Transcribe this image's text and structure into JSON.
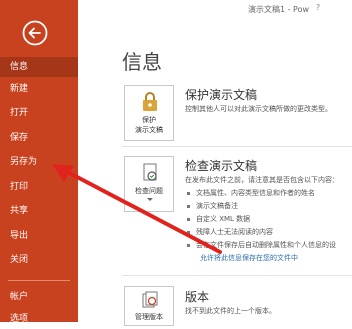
{
  "window": {
    "title": "演示文稿1 - Pow"
  },
  "sidebar": {
    "items": [
      {
        "label": "信息",
        "active": true
      },
      {
        "label": "新建"
      },
      {
        "label": "打开"
      },
      {
        "label": "保存"
      },
      {
        "label": "另存为"
      },
      {
        "label": "打印"
      },
      {
        "label": "共享"
      },
      {
        "label": "导出"
      },
      {
        "label": "关闭"
      },
      {
        "label": "帐户"
      },
      {
        "label": "选项"
      }
    ]
  },
  "main": {
    "title": "信息",
    "protect": {
      "button_line1": "保护",
      "button_line2": "演示文稿",
      "title": "保护演示文稿",
      "desc": "控制其他人可以对此演示文稿所做的更改类型。"
    },
    "inspect": {
      "button_label": "检查问题",
      "title": "检查演示文稿",
      "desc": "在发布此文件之前，请注意其是否包含以下内容：",
      "bullets": [
        "文档属性、内容类型信息和作者的姓名",
        "演示文稿备注",
        "自定义 XML 数据",
        "残障人士无法阅读的内容",
        "会在文件保存后自动删除属性和个人信息的设"
      ],
      "link": "允许将此信息保存在您的文件中"
    },
    "versions": {
      "button_label": "管理版本",
      "title": "版本",
      "desc": "找不到此文件的上一个版本。"
    }
  },
  "colors": {
    "sidebar": "#c9421f",
    "active": "#a53617",
    "arrow": "#e0231c"
  }
}
